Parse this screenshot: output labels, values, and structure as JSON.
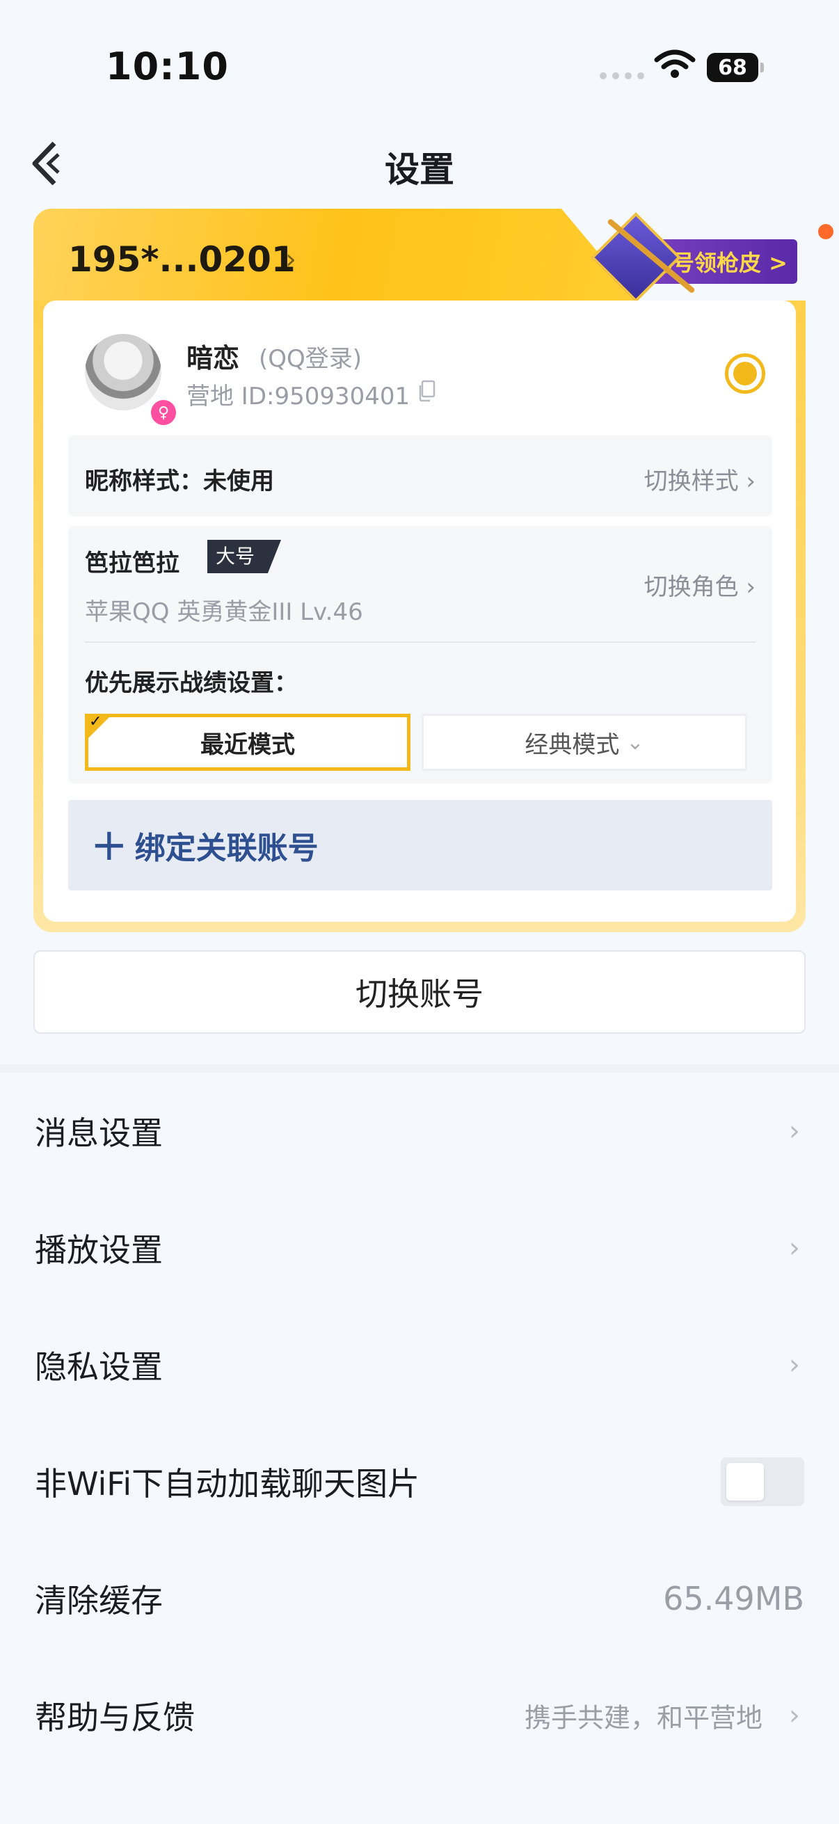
{
  "status_bar": {
    "time": "10:10",
    "battery": "68"
  },
  "header": {
    "title": "设置"
  },
  "account": {
    "masked_number": "195*...0201",
    "promo_label": "绑号领枪皮 >",
    "nickname": "暗恋",
    "login_type": "(QQ登录)",
    "camp_id": "营地 ID:950930401",
    "nick_style_label": "昵称样式：未使用",
    "nick_style_action": "切换样式",
    "role_name": "笆拉笆拉",
    "role_tag": "大号",
    "role_info": "苹果QQ  英勇黄金III  Lv.46",
    "role_action": "切换角色",
    "battle_label": "优先展示战绩设置：",
    "mode_recent": "最近模式",
    "mode_classic": "经典模式",
    "bind_label": "绑定关联账号"
  },
  "switch_account": "切换账号",
  "settings": {
    "message": "消息设置",
    "playback": "播放设置",
    "privacy": "隐私设置",
    "wifi_images": "非WiFi下自动加载聊天图片",
    "wifi_images_enabled": false,
    "clear_cache": "清除缓存",
    "cache_size": "65.49MB",
    "help": "帮助与反馈",
    "help_hint": "携手共建，和平营地"
  }
}
